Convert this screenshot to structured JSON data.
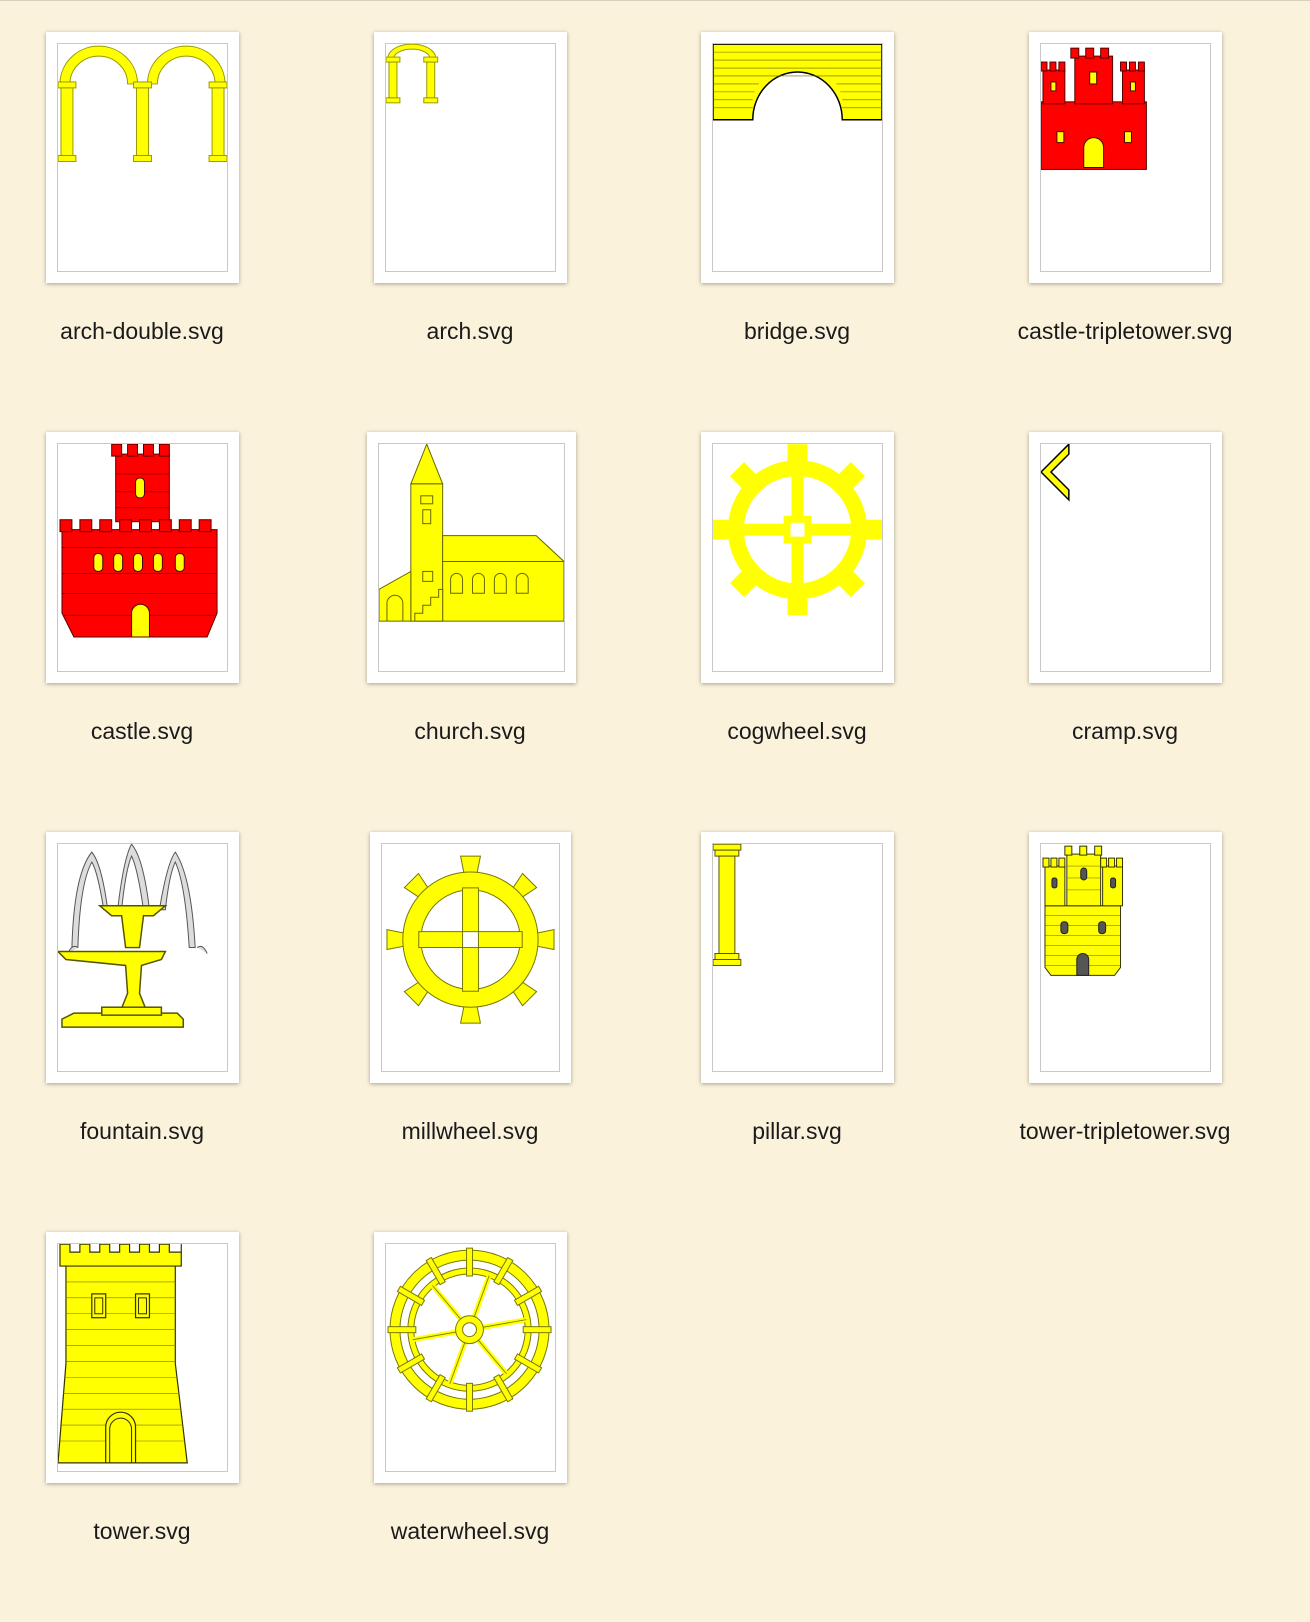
{
  "files": [
    {
      "name": "arch-double.svg",
      "icon": "arch-double-icon"
    },
    {
      "name": "arch.svg",
      "icon": "arch-icon"
    },
    {
      "name": "bridge.svg",
      "icon": "bridge-icon"
    },
    {
      "name": "castle-tripletower.svg",
      "icon": "castle-tripletower-icon"
    },
    {
      "name": "castle.svg",
      "icon": "castle-icon"
    },
    {
      "name": "church.svg",
      "icon": "church-icon"
    },
    {
      "name": "cogwheel.svg",
      "icon": "cogwheel-icon"
    },
    {
      "name": "cramp.svg",
      "icon": "cramp-icon"
    },
    {
      "name": "fountain.svg",
      "icon": "fountain-icon"
    },
    {
      "name": "millwheel.svg",
      "icon": "millwheel-icon"
    },
    {
      "name": "pillar.svg",
      "icon": "pillar-icon"
    },
    {
      "name": "tower-tripletower.svg",
      "icon": "tower-tripletower-icon"
    },
    {
      "name": "tower.svg",
      "icon": "tower-icon"
    },
    {
      "name": "waterwheel.svg",
      "icon": "waterwheel-icon"
    }
  ],
  "colors": {
    "background": "#fbf2dc",
    "charge_yellow": "#ffff00",
    "charge_red": "#ff0000"
  }
}
